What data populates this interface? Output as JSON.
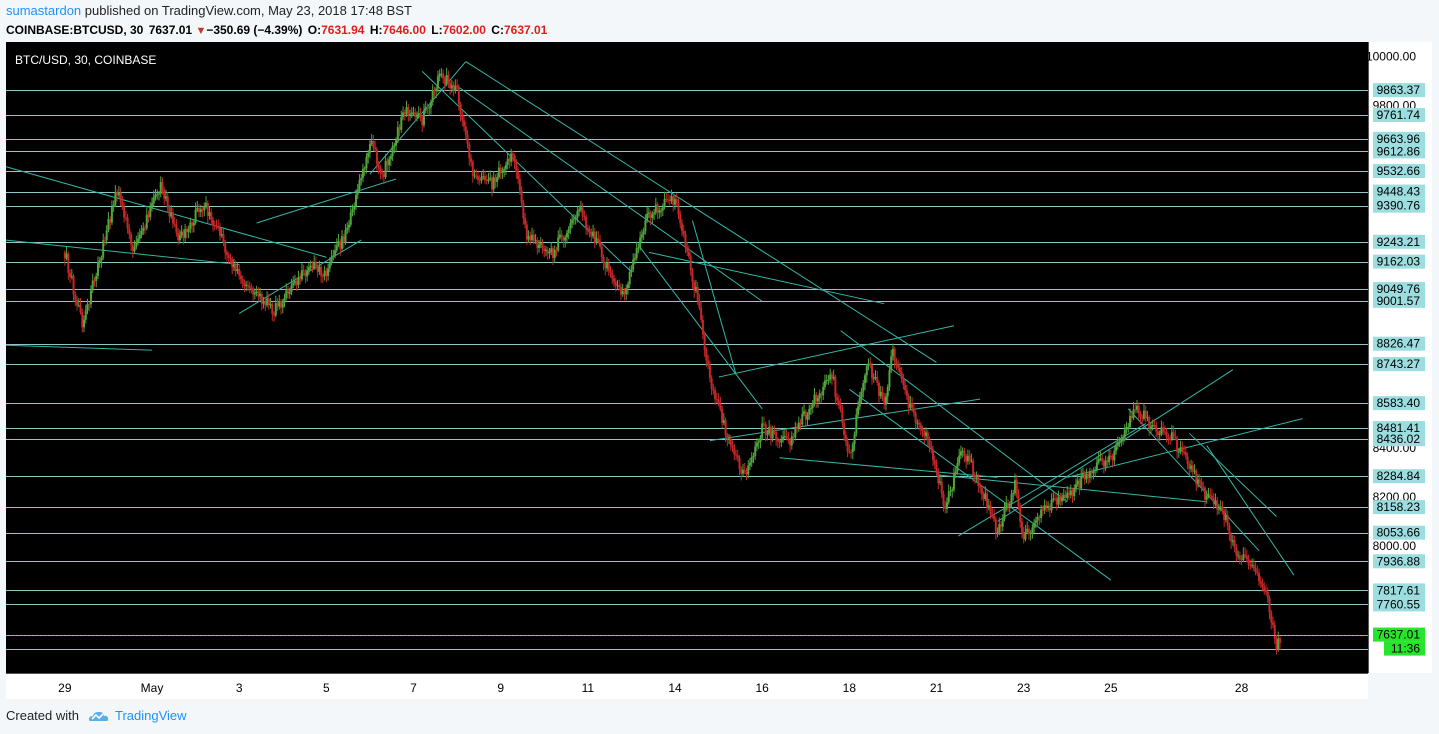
{
  "header": {
    "author": "sumastardon",
    "published_text": "published on TradingView.com, May 23, 2018 17:48 BST"
  },
  "symbol_bar": {
    "symbol": "COINBASE:BTCUSD, 30",
    "last": "7637.01",
    "change": "−350.69 (−4.39%)",
    "open_label": "O:",
    "open": "7631.94",
    "high_label": "H:",
    "high": "7646.00",
    "low_label": "L:",
    "low": "7602.00",
    "close_label": "C:",
    "close": "7637.01"
  },
  "footer": {
    "created_with": "Created with",
    "brand": "TradingView"
  },
  "colors": {
    "background": "#000000",
    "level_line": "#9cdde0",
    "trend_line": "#35b6a6",
    "candle_up": "#51a63c",
    "candle_down": "#c62828",
    "label_box": "#9cdde0",
    "price_tag": "#27e52a"
  },
  "chart_data": {
    "type": "candlestick",
    "title": "BTC/USD, 30, COINBASE",
    "x_tick_labels": [
      "29",
      "May",
      "3",
      "5",
      "7",
      "9",
      "11",
      "14",
      "16",
      "18",
      "21",
      "23",
      "25",
      "28"
    ],
    "y_tick_labels": [
      "10000.00",
      "9800.00",
      "8400.00",
      "8200.00",
      "8000.00"
    ],
    "horizontal_levels": [
      9863.37,
      9761.74,
      9663.96,
      9612.86,
      9532.66,
      9448.43,
      9390.76,
      9243.21,
      9162.03,
      9049.76,
      9001.57,
      8826.47,
      8743.27,
      8583.4,
      8481.41,
      8436.02,
      8284.84,
      8158.23,
      8053.66,
      7936.88,
      7817.61,
      7760.55,
      7637.01,
      7580.0
    ],
    "labeled_levels": [
      "9863.37",
      "9761.74",
      "9663.96",
      "9612.86",
      "9532.66",
      "9448.43",
      "9390.76",
      "9243.21",
      "9162.03",
      "9049.76",
      "9001.57",
      "8826.47",
      "8743.27",
      "8583.40",
      "8481.41",
      "8436.02",
      "8284.84",
      "8158.23",
      "8053.66",
      "7936.88",
      "7817.61",
      "7760.55"
    ],
    "current_price": "7637.01",
    "countdown": "11:36",
    "ylim": [
      7480,
      10060
    ],
    "price_path": [
      [
        0,
        9200
      ],
      [
        4,
        8900
      ],
      [
        12,
        9450
      ],
      [
        16,
        9200
      ],
      [
        22,
        9480
      ],
      [
        26,
        9250
      ],
      [
        32,
        9400
      ],
      [
        40,
        9100
      ],
      [
        48,
        8960
      ],
      [
        56,
        9140
      ],
      [
        60,
        9120
      ],
      [
        65,
        9300
      ],
      [
        70,
        9650
      ],
      [
        73,
        9520
      ],
      [
        78,
        9780
      ],
      [
        82,
        9740
      ],
      [
        86,
        9930
      ],
      [
        90,
        9860
      ],
      [
        94,
        9500
      ],
      [
        98,
        9480
      ],
      [
        103,
        9620
      ],
      [
        106,
        9260
      ],
      [
        112,
        9200
      ],
      [
        118,
        9380
      ],
      [
        124,
        9160
      ],
      [
        128,
        9020
      ],
      [
        134,
        9360
      ],
      [
        140,
        9420
      ],
      [
        143,
        9180
      ],
      [
        145,
        9020
      ],
      [
        148,
        8680
      ],
      [
        151,
        8500
      ],
      [
        156,
        8280
      ],
      [
        160,
        8480
      ],
      [
        166,
        8420
      ],
      [
        172,
        8600
      ],
      [
        176,
        8700
      ],
      [
        180,
        8360
      ],
      [
        184,
        8760
      ],
      [
        188,
        8580
      ],
      [
        190,
        8800
      ],
      [
        194,
        8560
      ],
      [
        198,
        8450
      ],
      [
        202,
        8150
      ],
      [
        206,
        8400
      ],
      [
        210,
        8250
      ],
      [
        214,
        8050
      ],
      [
        218,
        8250
      ],
      [
        220,
        8020
      ],
      [
        224,
        8150
      ],
      [
        230,
        8200
      ],
      [
        236,
        8320
      ],
      [
        240,
        8360
      ],
      [
        246,
        8560
      ],
      [
        250,
        8480
      ],
      [
        254,
        8440
      ],
      [
        258,
        8330
      ],
      [
        262,
        8200
      ],
      [
        266,
        8130
      ],
      [
        269,
        7960
      ],
      [
        272,
        7920
      ],
      [
        276,
        7790
      ],
      [
        278,
        7580
      ],
      [
        279,
        7637
      ]
    ],
    "time_scale": {
      "interval_minutes": 30,
      "ticks": [
        {
          "label": "29",
          "t": 0
        },
        {
          "label": "May",
          "t": 20
        },
        {
          "label": "3",
          "t": 40
        },
        {
          "label": "5",
          "t": 60
        },
        {
          "label": "7",
          "t": 80
        },
        {
          "label": "9",
          "t": 100
        },
        {
          "label": "11",
          "t": 120
        },
        {
          "label": "14",
          "t": 140
        },
        {
          "label": "16",
          "t": 160
        },
        {
          "label": "18",
          "t": 180
        },
        {
          "label": "21",
          "t": 200
        },
        {
          "label": "23",
          "t": 220
        },
        {
          "label": "25",
          "t": 240
        },
        {
          "label": "28",
          "t": 270
        }
      ],
      "xlim": [
        -13.5,
        299
      ]
    },
    "trend_lines": [
      [
        [
          -13.5,
          9250
        ],
        [
          40,
          9150
        ]
      ],
      [
        [
          -13.5,
          9550
        ],
        [
          60,
          9180
        ]
      ],
      [
        [
          -13.5,
          8820
        ],
        [
          20,
          8800
        ]
      ],
      [
        [
          40,
          8950
        ],
        [
          68,
          9250
        ]
      ],
      [
        [
          44,
          9320
        ],
        [
          76,
          9500
        ]
      ],
      [
        [
          70,
          9520
        ],
        [
          92,
          9980
        ]
      ],
      [
        [
          82,
          9940
        ],
        [
          130,
          9120
        ]
      ],
      [
        [
          90,
          9880
        ],
        [
          160,
          9000
        ]
      ],
      [
        [
          92,
          9980
        ],
        [
          200,
          8750
        ]
      ],
      [
        [
          132,
          9220
        ],
        [
          160,
          8560
        ]
      ],
      [
        [
          134,
          9200
        ],
        [
          188,
          8990
        ]
      ],
      [
        [
          144,
          9330
        ],
        [
          154,
          8700
        ]
      ],
      [
        [
          150,
          8690
        ],
        [
          204,
          8900
        ]
      ],
      [
        [
          148,
          8430
        ],
        [
          210,
          8600
        ]
      ],
      [
        [
          164,
          8360
        ],
        [
          214,
          8280
        ]
      ],
      [
        [
          178,
          8880
        ],
        [
          230,
          8180
        ]
      ],
      [
        [
          180,
          8640
        ],
        [
          240,
          7860
        ]
      ],
      [
        [
          200,
          8290
        ],
        [
          262,
          8180
        ]
      ],
      [
        [
          205,
          8040
        ],
        [
          248,
          8500
        ]
      ],
      [
        [
          214,
          8100
        ],
        [
          268,
          8720
        ]
      ],
      [
        [
          230,
          8280
        ],
        [
          284,
          8520
        ]
      ],
      [
        [
          244,
          8560
        ],
        [
          274,
          7980
        ]
      ],
      [
        [
          258,
          8460
        ],
        [
          278,
          8120
        ]
      ],
      [
        [
          262,
          8410
        ],
        [
          282,
          7880
        ]
      ]
    ]
  }
}
